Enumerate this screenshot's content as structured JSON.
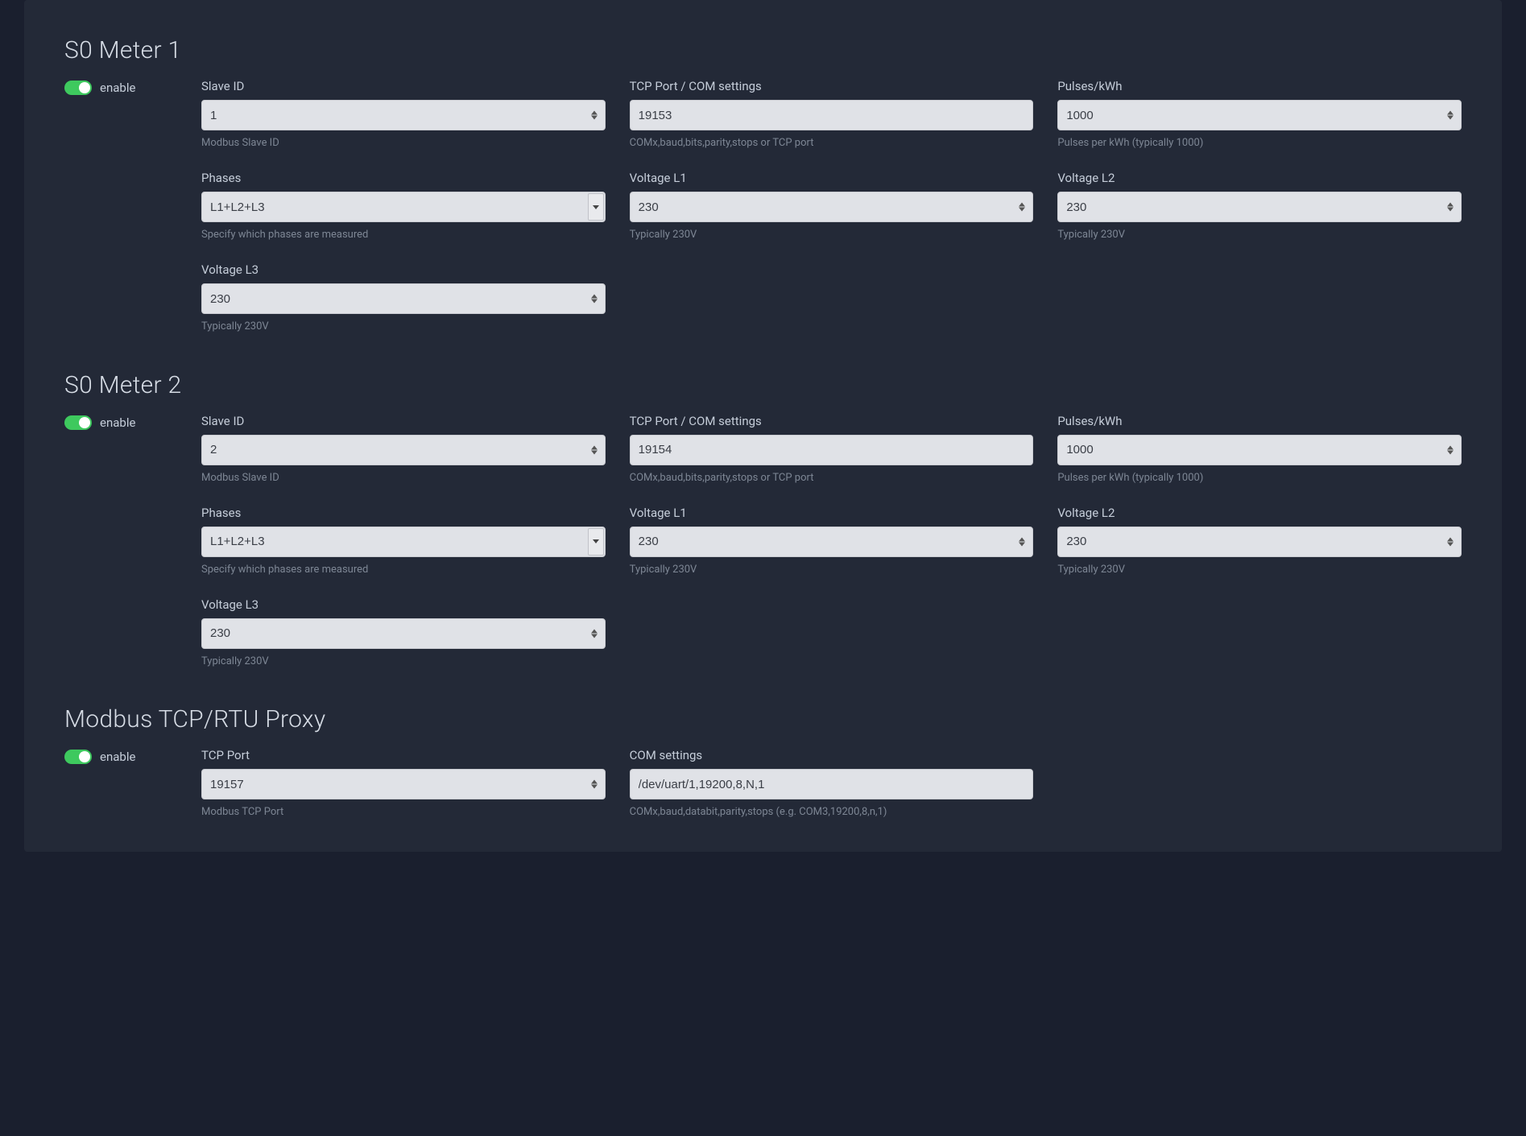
{
  "sections": {
    "meter1": {
      "title": "S0 Meter 1",
      "enable_label": "enable",
      "fields": {
        "slave_id": {
          "label": "Slave ID",
          "value": "1",
          "help": "Modbus Slave ID"
        },
        "tcp_port": {
          "label": "TCP Port / COM settings",
          "value": "19153",
          "help": "COMx,baud,bits,parity,stops or TCP port"
        },
        "pulses": {
          "label": "Pulses/kWh",
          "value": "1000",
          "help": "Pulses per kWh (typically 1000)"
        },
        "phases": {
          "label": "Phases",
          "value": "L1+L2+L3",
          "help": "Specify which phases are measured"
        },
        "voltage_l1": {
          "label": "Voltage L1",
          "value": "230",
          "help": "Typically 230V"
        },
        "voltage_l2": {
          "label": "Voltage L2",
          "value": "230",
          "help": "Typically 230V"
        },
        "voltage_l3": {
          "label": "Voltage L3",
          "value": "230",
          "help": "Typically 230V"
        }
      }
    },
    "meter2": {
      "title": "S0 Meter 2",
      "enable_label": "enable",
      "fields": {
        "slave_id": {
          "label": "Slave ID",
          "value": "2",
          "help": "Modbus Slave ID"
        },
        "tcp_port": {
          "label": "TCP Port / COM settings",
          "value": "19154",
          "help": "COMx,baud,bits,parity,stops or TCP port"
        },
        "pulses": {
          "label": "Pulses/kWh",
          "value": "1000",
          "help": "Pulses per kWh (typically 1000)"
        },
        "phases": {
          "label": "Phases",
          "value": "L1+L2+L3",
          "help": "Specify which phases are measured"
        },
        "voltage_l1": {
          "label": "Voltage L1",
          "value": "230",
          "help": "Typically 230V"
        },
        "voltage_l2": {
          "label": "Voltage L2",
          "value": "230",
          "help": "Typically 230V"
        },
        "voltage_l3": {
          "label": "Voltage L3",
          "value": "230",
          "help": "Typically 230V"
        }
      }
    },
    "proxy": {
      "title": "Modbus TCP/RTU Proxy",
      "enable_label": "enable",
      "fields": {
        "tcp_port": {
          "label": "TCP Port",
          "value": "19157",
          "help": "Modbus TCP Port"
        },
        "com_settings": {
          "label": "COM settings",
          "value": "/dev/uart/1,19200,8,N,1",
          "help": "COMx,baud,databit,parity,stops (e.g. COM3,19200,8,n,1)"
        }
      }
    }
  }
}
